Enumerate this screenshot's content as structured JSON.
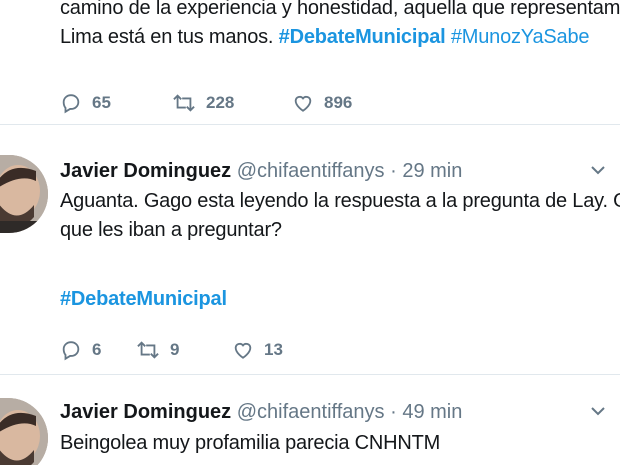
{
  "tweets": [
    {
      "text_line1": "camino de la experiencia y honestidad, aquella que representamos. El futuro de",
      "text_line2_plain": "Lima está en tus manos. ",
      "hashtag1": "#DebateMunicipal",
      "hashtag2": "#MunozYaSabe",
      "replies": "65",
      "retweets": "228",
      "likes": "896"
    },
    {
      "display_name": "Javier Dominguez",
      "handle": "@chifaentiffanys",
      "separator": "·",
      "time": "29 min",
      "text_line1": "Aguanta. Gago esta leyendo la respuesta a la pregunta de Lay. O sea ya sabían lo",
      "text_line2": "que les iban a preguntar?",
      "hashtag": "#DebateMunicipal",
      "replies": "6",
      "retweets": "9",
      "likes": "13"
    },
    {
      "display_name": "Javier Dominguez",
      "handle": "@chifaentiffanys",
      "separator": "·",
      "time": "49 min",
      "text_line1": "Beingolea muy profamilia parecia CNHNTM"
    }
  ],
  "colors": {
    "link": "#1b95e0",
    "secondary": "#657786",
    "divider": "#e1e8ed"
  },
  "icons": [
    "reply-icon",
    "retweet-icon",
    "like-icon",
    "chevron-down-icon"
  ]
}
